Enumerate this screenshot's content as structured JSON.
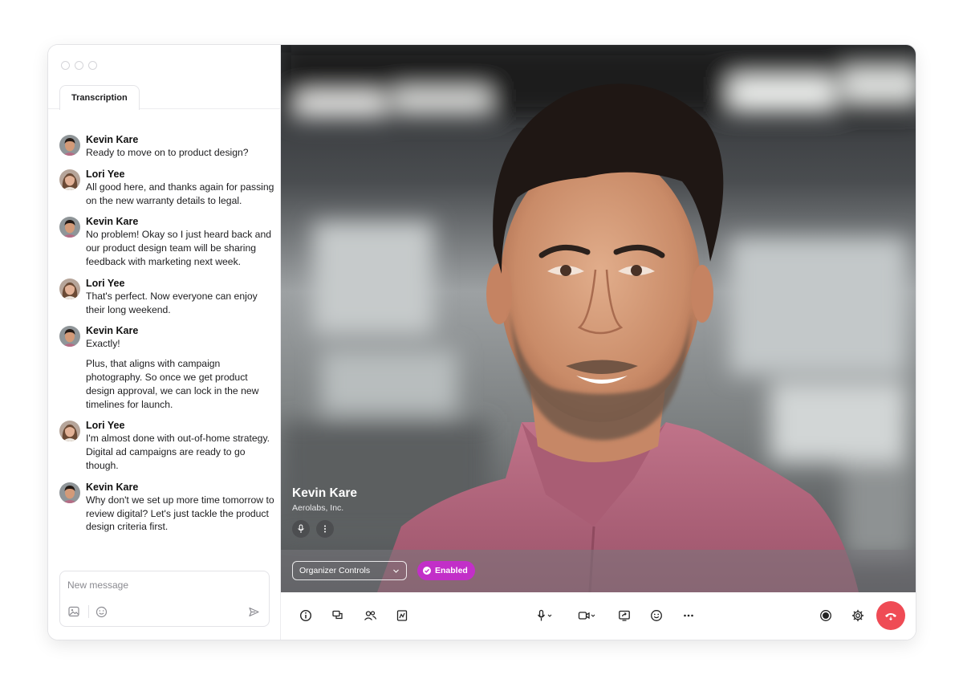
{
  "sidebar": {
    "tab_label": "Transcription",
    "messages": [
      {
        "speaker": "Kevin Kare",
        "lines": [
          "Ready to move on to product design?"
        ]
      },
      {
        "speaker": "Lori Yee",
        "lines": [
          "All good here, and thanks again for passing on the new warranty details to legal."
        ]
      },
      {
        "speaker": "Kevin Kare",
        "lines": [
          "No problem! Okay so I just heard back and our product design team will be sharing feedback with marketing next week."
        ]
      },
      {
        "speaker": "Lori Yee",
        "lines": [
          "That's perfect. Now everyone can enjoy their long weekend."
        ]
      },
      {
        "speaker": "Kevin Kare",
        "lines": [
          "Exactly!",
          "Plus, that aligns with campaign photography. So once we get product design approval, we can lock in the new timelines for launch."
        ]
      },
      {
        "speaker": "Lori Yee",
        "lines": [
          "I'm almost done with out-of-home strategy. Digital ad campaigns are ready to go though."
        ]
      },
      {
        "speaker": "Kevin Kare",
        "lines": [
          "Why don't we set up more time tomorrow to review digital? Let's just tackle the product design criteria first."
        ]
      }
    ],
    "composer": {
      "placeholder": "New message",
      "value": ""
    }
  },
  "video": {
    "speaker_name": "Kevin Kare",
    "speaker_org": "Aerolabs, Inc.",
    "organizer_controls_label": "Organizer Controls",
    "enabled_label": "Enabled"
  },
  "toolbar": {
    "left_icons": [
      "info-icon",
      "chat-icon",
      "participants-icon",
      "whiteboard-icon"
    ],
    "center_icons": [
      "microphone-icon",
      "camera-icon",
      "share-screen-icon",
      "emoji-icon",
      "more-icon"
    ],
    "right_icons": [
      "record-icon",
      "settings-icon",
      "hang-up-icon"
    ]
  },
  "colors": {
    "accent_pill": "#c22fc8",
    "hang_up": "#ef4b55",
    "shirt": "#b5677f"
  }
}
